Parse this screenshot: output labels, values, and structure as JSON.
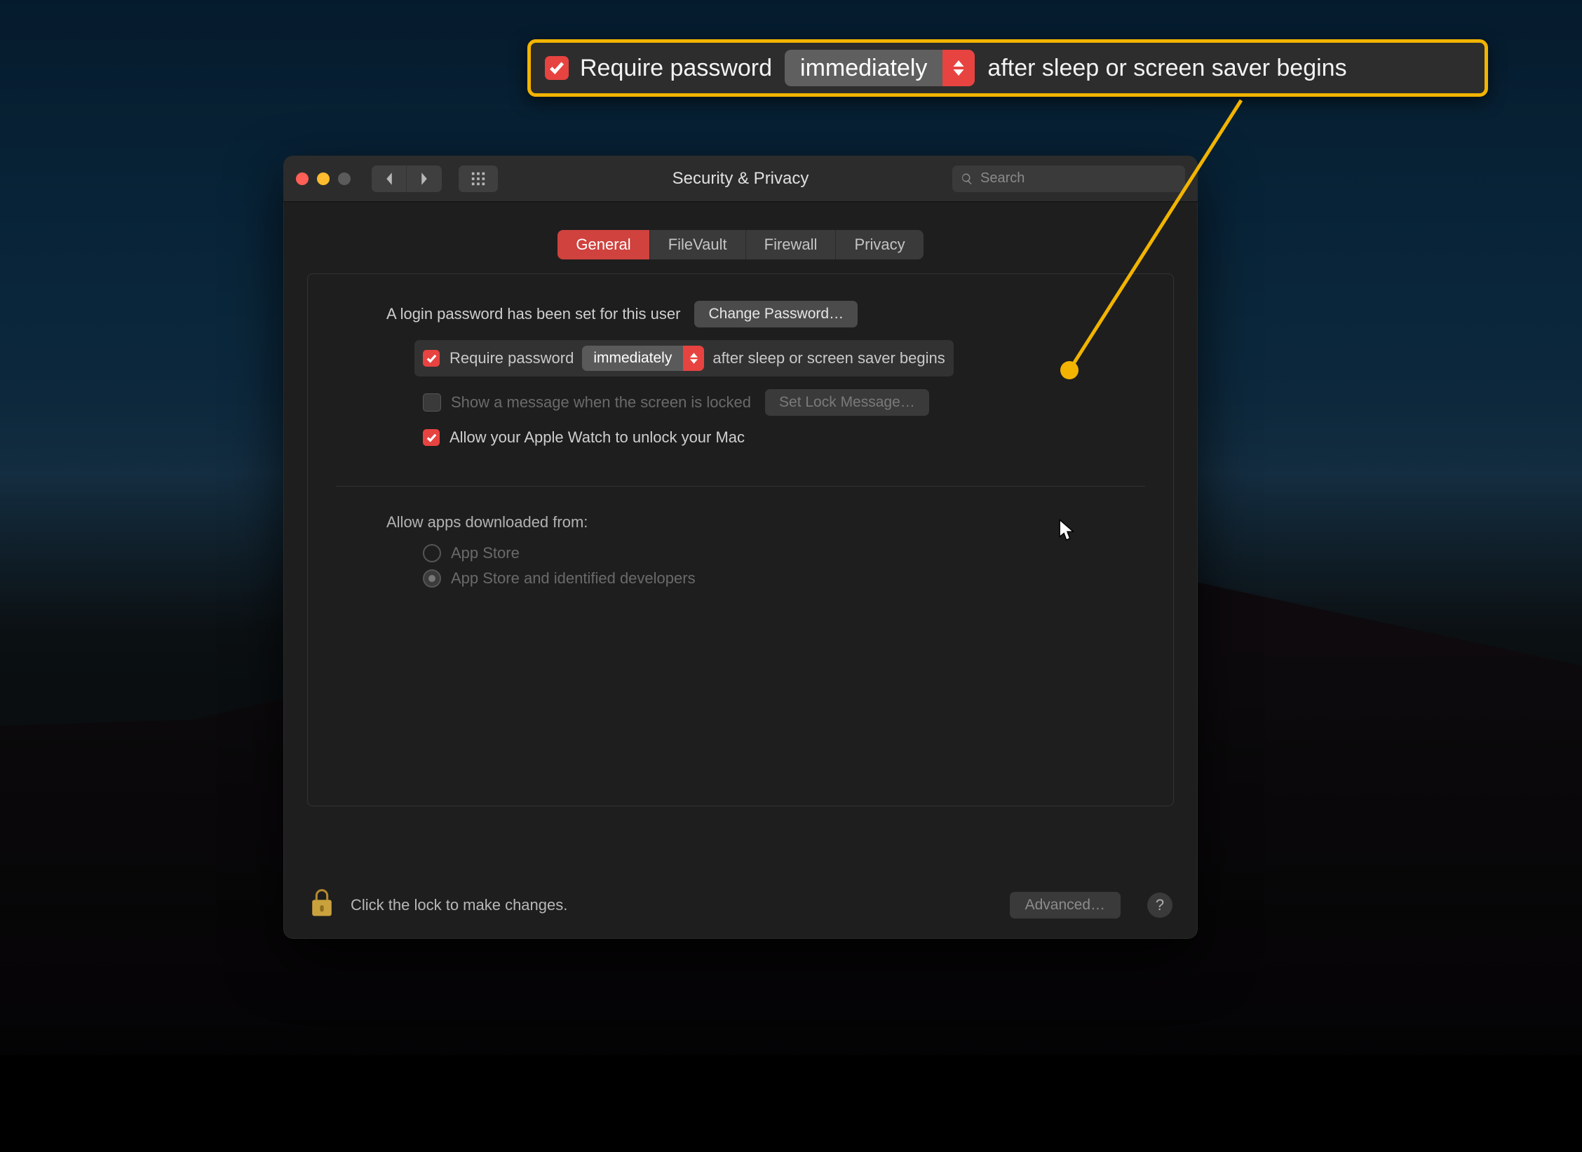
{
  "callout": {
    "require_password_label": "Require password",
    "delay_value": "immediately",
    "after_text": "after sleep or screen saver begins"
  },
  "window": {
    "title": "Security & Privacy",
    "search_placeholder": "Search",
    "tabs": [
      "General",
      "FileVault",
      "Firewall",
      "Privacy"
    ],
    "active_tab": "General",
    "login_password_text": "A login password has been set for this user",
    "change_password_btn": "Change Password…",
    "require_password_label": "Require password",
    "delay_value": "immediately",
    "after_text": "after sleep or screen saver begins",
    "show_message_label": "Show a message when the screen is locked",
    "set_lock_message_btn": "Set Lock Message…",
    "apple_watch_label": "Allow your Apple Watch to unlock your Mac",
    "allow_apps_heading": "Allow apps downloaded from:",
    "radio_app_store": "App Store",
    "radio_identified": "App Store and identified developers",
    "lock_message": "Click the lock to make changes.",
    "advanced_btn": "Advanced…",
    "help_glyph": "?"
  }
}
